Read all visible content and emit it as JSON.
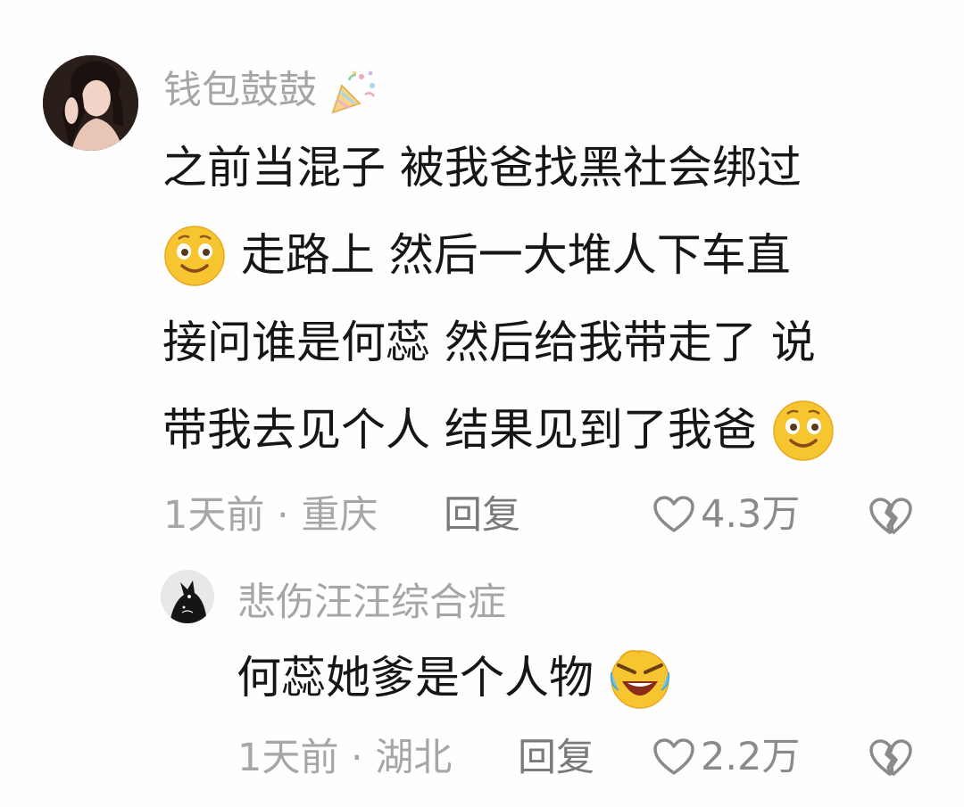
{
  "comments": [
    {
      "username": "钱包鼓鼓",
      "username_badge_icon": "party-popper-icon",
      "text_lines": [
        "之前当混子 被我爸找黑社会绑过",
        "走路上 然后一大堆人下车直",
        "接问谁是何蕊 然后给我带走了 说",
        "带我去见个人 结果见到了我爸"
      ],
      "inline_emojis": [
        "smirk-face-icon",
        "smirk-face-icon"
      ],
      "time": "1天前",
      "separator": "·",
      "location": "重庆",
      "reply_label": "回复",
      "like_count": "4.3万",
      "like_icon": "heart-outline-icon",
      "dislike_icon": "broken-heart-icon"
    },
    {
      "username": "悲伤汪汪综合症",
      "text_lines": [
        "何蕊她爹是个人物"
      ],
      "inline_emojis": [
        "laughing-crying-face-icon"
      ],
      "time": "1天前",
      "separator": "·",
      "location": "湖北",
      "reply_label": "回复",
      "like_count": "2.2万",
      "like_icon": "heart-outline-icon",
      "dislike_icon": "broken-heart-icon"
    }
  ],
  "colors": {
    "background": "#fefefe",
    "text": "#161616",
    "muted": "#a6a6a6",
    "emoji_yellow": "#f7c530"
  }
}
